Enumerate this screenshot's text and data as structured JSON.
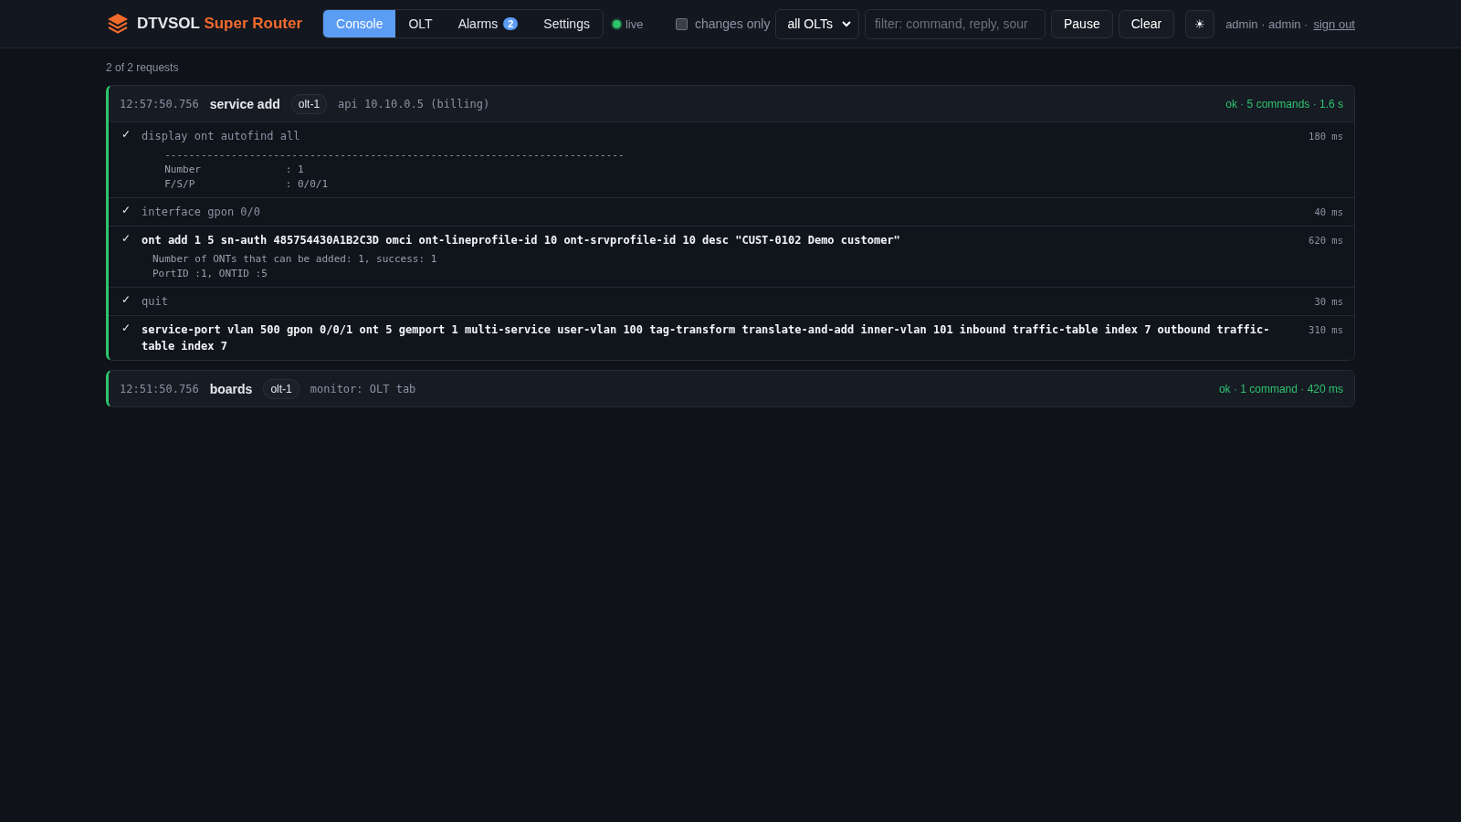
{
  "brand": {
    "name": "DTVSOL",
    "accent": "Super Router"
  },
  "tabs": [
    {
      "label": "Console",
      "selected": true
    },
    {
      "label": "OLT",
      "selected": false
    },
    {
      "label": "Alarms",
      "selected": false,
      "badge": "2"
    },
    {
      "label": "Settings",
      "selected": false
    }
  ],
  "live": {
    "label": "live",
    "on": true
  },
  "changes_only": {
    "label": "changes only",
    "checked": false
  },
  "olt_select": {
    "value": "all OLTs"
  },
  "filter": {
    "placeholder": "filter: command, reply, sour"
  },
  "buttons": [
    "Pause",
    "Clear"
  ],
  "theme_toggle": "☀",
  "user": {
    "text": "admin · admin ·",
    "link": "sign out"
  },
  "summary": "2 of 2 requests",
  "requests": [
    {
      "time": "12:57:50.756",
      "title": "service add",
      "olt": "olt-1",
      "source": "api 10.10.0.5 (billing)",
      "status": "ok · 5 commands · 1.6 s",
      "ok": true,
      "commands": [
        {
          "kind": "read",
          "mark": "✓",
          "text": "display ont autofind all",
          "duration": "180 ms",
          "output": [
            "  ----------------------------------------------------------------------------",
            "  Number              : 1",
            "  F/S/P               : 0/0/1"
          ]
        },
        {
          "kind": "read",
          "mark": "✓",
          "text": "interface gpon 0/0",
          "duration": "40 ms"
        },
        {
          "kind": "write",
          "mark": "✓",
          "text": "ont add 1 5 sn-auth 485754430A1B2C3D omci ont-lineprofile-id 10 ont-srvprofile-id 10 desc \"CUST-0102 Demo customer\"",
          "duration": "620 ms",
          "output": [
            "Number of ONTs that can be added: 1, success: 1",
            "PortID :1, ONTID :5"
          ]
        },
        {
          "kind": "read",
          "mark": "✓",
          "text": "quit",
          "duration": "30 ms"
        },
        {
          "kind": "write",
          "mark": "✓",
          "text": "service-port vlan 500 gpon 0/0/1 ont 5 gemport 1 multi-service user-vlan 100 tag-transform translate-and-add inner-vlan 101 inbound traffic-table index 7 outbound traffic-table index 7",
          "duration": "310 ms"
        }
      ]
    },
    {
      "time": "12:51:50.756",
      "title": "boards",
      "olt": "olt-1",
      "source": "monitor: OLT tab",
      "status": "ok · 1 command · 420 ms",
      "ok": true
    }
  ]
}
